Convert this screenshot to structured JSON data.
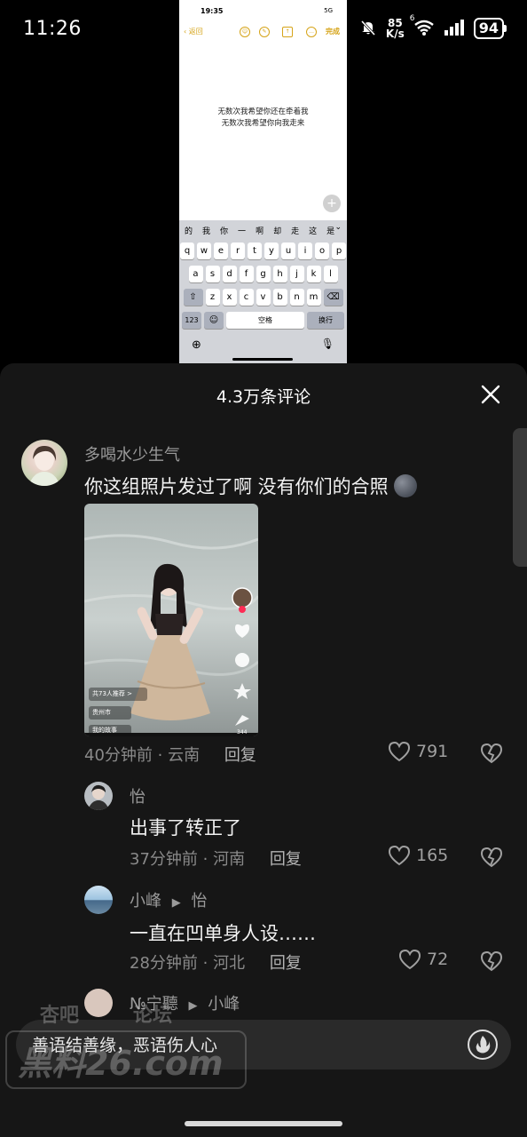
{
  "status_bar": {
    "time": "11:26",
    "speed_value": "85",
    "speed_unit": "K/s",
    "signal_label": "6",
    "battery": "94"
  },
  "embedded_screenshot": {
    "time": "19:35",
    "indicators": "5G",
    "back_label": "返回",
    "done_label": "完成",
    "note_lines": [
      "无数次我希望你还在牵着我",
      "无数次我希望你向我走来"
    ],
    "candidates": [
      "的",
      "我",
      "你",
      "一",
      "啊",
      "却",
      "走",
      "这",
      "是"
    ],
    "row1": [
      "q",
      "w",
      "e",
      "r",
      "t",
      "y",
      "u",
      "i",
      "o",
      "p"
    ],
    "row2": [
      "a",
      "s",
      "d",
      "f",
      "g",
      "h",
      "j",
      "k",
      "l"
    ],
    "row3": [
      "z",
      "x",
      "c",
      "v",
      "b",
      "n",
      "m"
    ],
    "key_123": "123",
    "space_label": "空格",
    "return_label": "换行"
  },
  "sheet": {
    "title": "4.3万条评论"
  },
  "comments": [
    {
      "user": "多喝水少生气",
      "text": "你这组照片发过了啊  没有你们的合照",
      "time_loc": "40分钟前 · 云南",
      "reply": "回复",
      "likes": "791",
      "photo": {
        "text_a": "共73人推荐 >",
        "text_b": "贵州市",
        "text_c": "我的故事",
        "count": "344"
      }
    },
    {
      "user": "怡",
      "text": "出事了转正了",
      "time_loc": "37分钟前 · 河南",
      "reply": "回复",
      "likes": "165"
    },
    {
      "user": "小峰",
      "reply_to": "怡",
      "text": "一直在凹单身人设……",
      "time_loc": "28分钟前 · 河北",
      "reply": "回复",
      "likes": "72"
    },
    {
      "user": "№宁聽",
      "reply_to": "小峰"
    }
  ],
  "input": {
    "placeholder": "善语结善缘，恶语伤人心"
  },
  "watermark": {
    "line1": "杏吧",
    "line2": "论坛",
    "line3": "黑料26.com"
  },
  "colors": {
    "sheet_bg": "#161616",
    "input_bg": "#2a2a2a",
    "accent_yellow": "#d6a419"
  }
}
